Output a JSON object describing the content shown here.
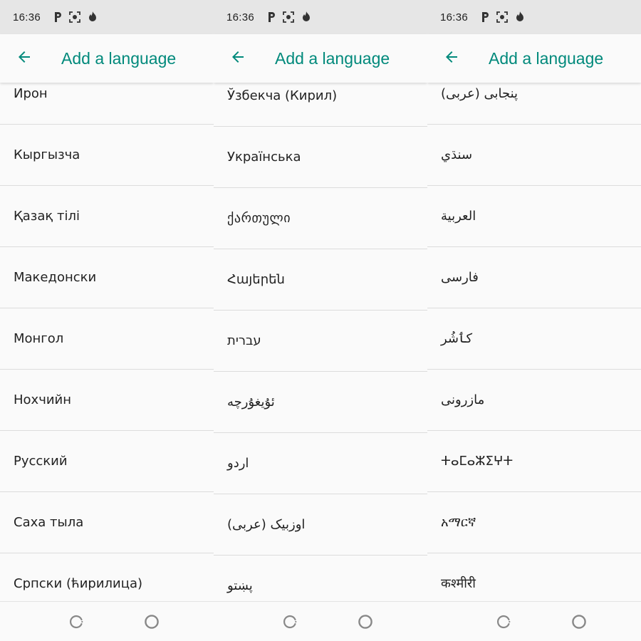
{
  "colors": {
    "accent": "#00897b",
    "status_bar": "#e6e6e6",
    "background": "#fafafa",
    "divider": "#dcdcdc",
    "text": "#222222"
  },
  "icons": {
    "status": [
      "parking-icon",
      "screenshot-icon",
      "flame-icon"
    ],
    "back": "arrow-left-icon",
    "nav": [
      "loading-spinner-icon",
      "home-circle-icon"
    ]
  },
  "screens": [
    {
      "status": {
        "time": "16:36"
      },
      "title": "Add a language",
      "languages": [
        "Ирон",
        "Кыргызча",
        "Қазақ тілі",
        "Македонски",
        "Монгол",
        "Нохчийн",
        "Русский",
        "Саха тыла",
        "Српски (ћирилица)"
      ]
    },
    {
      "status": {
        "time": "16:36"
      },
      "title": "Add a language",
      "languages": [
        "Ўзбекча (Кирил)",
        "Українська",
        "ქართული",
        "Հայերեն",
        "עברית",
        "ئۇيغۇرچە",
        "اردو",
        "اوزبیک (عربی)",
        "پښتو"
      ]
    },
    {
      "status": {
        "time": "16:36"
      },
      "title": "Add a language",
      "languages": [
        "پنجابی (عربی)",
        "سنڌي",
        "العربية",
        "فارسی",
        "کٲشُر",
        "مازرونی",
        "ⵜⴰⵎⴰⵣⵉⵖⵜ",
        "አማርኛ",
        "कश्मीरी"
      ]
    }
  ]
}
